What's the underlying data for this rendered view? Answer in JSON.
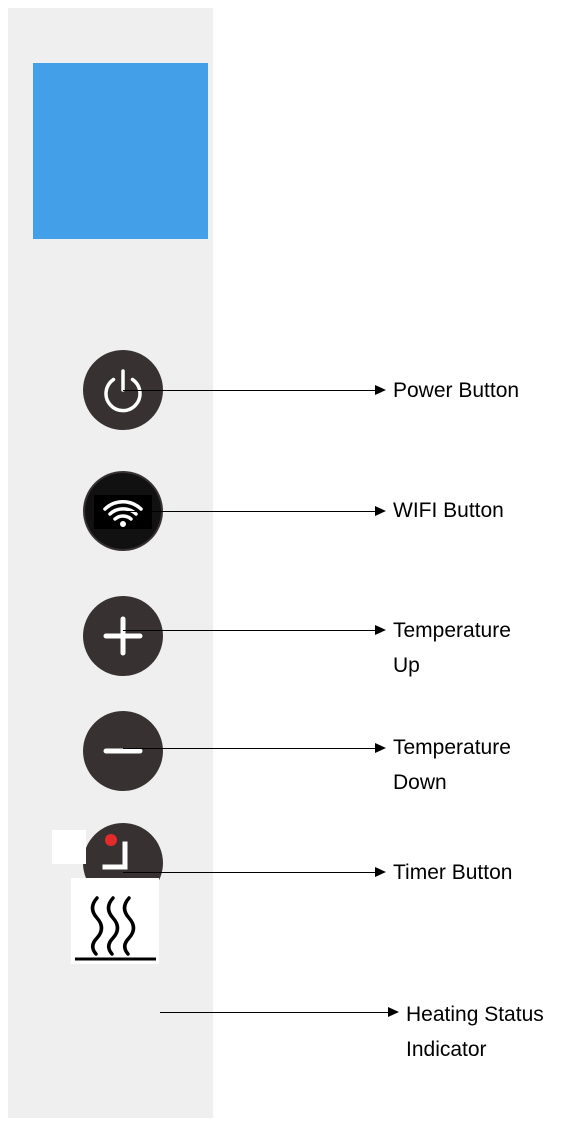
{
  "device": {
    "panel_color": "#efefef",
    "display_color": "#439fe8",
    "button_color": "#373131",
    "indicator_dot_color": "#e32b2b"
  },
  "buttons": [
    {
      "name": "power-button",
      "icon": "power-icon",
      "label": "Power Button"
    },
    {
      "name": "wifi-button",
      "icon": "wifi-icon",
      "label": "WIFI Button"
    },
    {
      "name": "temperature-up-button",
      "icon": "plus-icon",
      "label": "Temperature\nUp"
    },
    {
      "name": "temperature-down-button",
      "icon": "minus-icon",
      "label": "Temperature\nDown"
    },
    {
      "name": "timer-button",
      "icon": "timer-icon",
      "label": "Timer Button"
    }
  ],
  "indicators": {
    "heating": {
      "icon": "heating-waves-icon",
      "label": "Heating Status\nIndicator"
    }
  }
}
